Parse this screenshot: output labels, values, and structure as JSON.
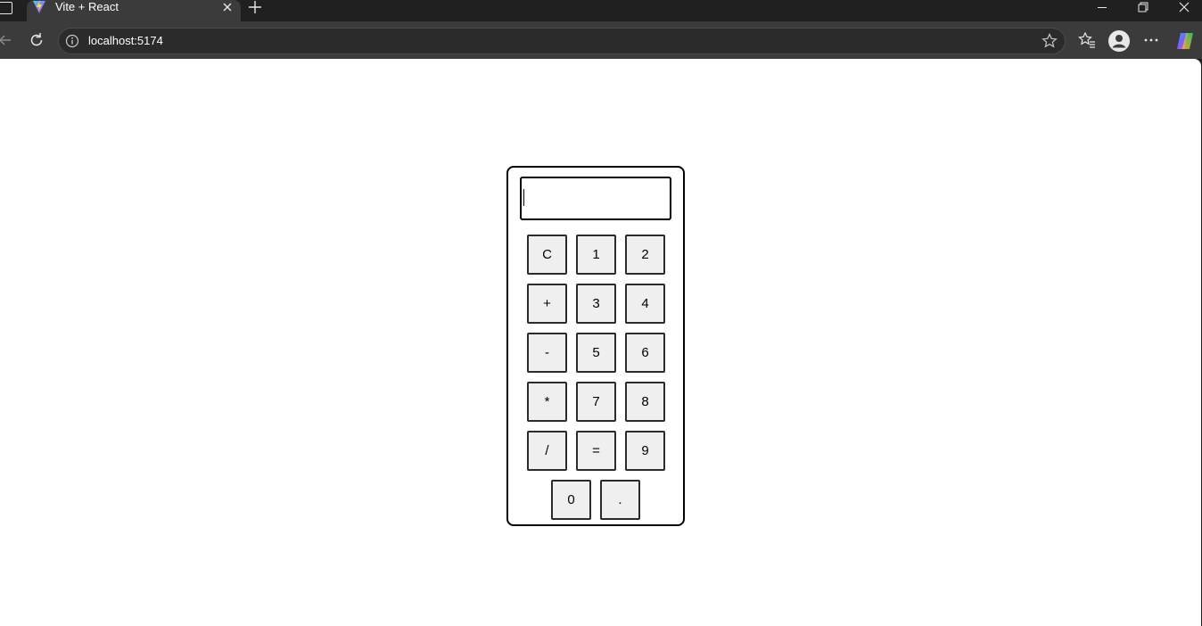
{
  "browser": {
    "tab_title": "Vite + React",
    "url": "localhost:5174"
  },
  "calculator": {
    "display_value": "",
    "keys": {
      "clear": "C",
      "one": "1",
      "two": "2",
      "plus": "+",
      "three": "3",
      "four": "4",
      "minus": "-",
      "five": "5",
      "six": "6",
      "multiply": "*",
      "seven": "7",
      "eight": "8",
      "divide": "/",
      "equals": "=",
      "nine": "9",
      "zero": "0",
      "decimal": "."
    }
  }
}
